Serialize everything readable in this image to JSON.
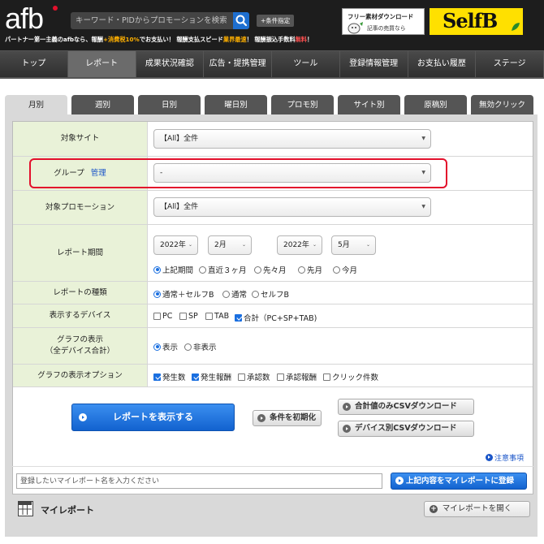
{
  "header": {
    "logo_text": "afb",
    "search_placeholder": "キーワード・PIDからプロモーションを検索",
    "condition_button": "+条件指定",
    "tagline": {
      "part1": "パートナー第一主義のafbなら、報酬",
      "part2": "+消費税10%",
      "part3": "でお支払い！ 報酬支払スピード",
      "part4": "業界最速",
      "part5": "！ 報酬振込手数料",
      "part6": "無料",
      "part7": "！"
    },
    "banner1": {
      "line1": "フリー素材ダウンロード",
      "line2": "記事の売買なら"
    },
    "banner2": {
      "text": "SelfB"
    }
  },
  "main_nav": [
    "トップ",
    "レポート",
    "成果状況確認",
    "広告・提携管理",
    "ツール",
    "登録情報管理",
    "お支払い履歴",
    "ステージ"
  ],
  "main_nav_active": 1,
  "sub_tabs": [
    "月別",
    "週別",
    "日別",
    "曜日別",
    "プロモ別",
    "サイト別",
    "原稿別",
    "無効クリック"
  ],
  "sub_tab_active": 0,
  "form": {
    "target_site": {
      "label": "対象サイト",
      "value": "【All】全件"
    },
    "group": {
      "label": "グループ",
      "link": "管理",
      "value": "-"
    },
    "target_promotion": {
      "label": "対象プロモーション",
      "value": "【All】全件"
    },
    "period": {
      "label": "レポート期間",
      "from_year": "2022年",
      "from_month": "2月",
      "to_year": "2022年",
      "to_month": "5月",
      "options": [
        "上記期間",
        "直近３ヶ月",
        "先々月",
        "先月",
        "今月"
      ],
      "selected": 0
    },
    "report_type": {
      "label": "レポートの種類",
      "options": [
        "通常＋セルフB",
        "通常",
        "セルフB"
      ],
      "selected": 0
    },
    "device": {
      "label": "表示するデバイス",
      "options": [
        "PC",
        "SP",
        "TAB",
        "合計（PC+SP+TAB)"
      ],
      "checked": [
        false,
        false,
        false,
        true
      ]
    },
    "graph_display": {
      "label_line1": "グラフの表示",
      "label_line2": "（全デバイス合計）",
      "options": [
        "表示",
        "非表示"
      ],
      "selected": 0
    },
    "graph_options": {
      "label": "グラフの表示オプション",
      "options": [
        "発生数",
        "発生報酬",
        "承認数",
        "承認報酬",
        "クリック件数"
      ],
      "checked": [
        true,
        true,
        false,
        false,
        false
      ]
    }
  },
  "actions": {
    "show_report": "レポートを表示する",
    "reset_conditions": "条件を初期化",
    "csv_total": "合計値のみCSVダウンロード",
    "csv_device": "デバイス別CSVダウンロード",
    "notes": "注意事項",
    "myreport_placeholder": "登録したいマイレポート名を入力ください",
    "register_myreport": "上記内容をマイレポートに登録"
  },
  "myreport": {
    "title": "マイレポート",
    "open_button": "マイレポートを開く"
  },
  "colors": {
    "accent_blue": "#1a6fe0",
    "highlight_red": "#e3102c",
    "label_green": "#e9f2d8",
    "header_bg": "#1d1d1d"
  }
}
